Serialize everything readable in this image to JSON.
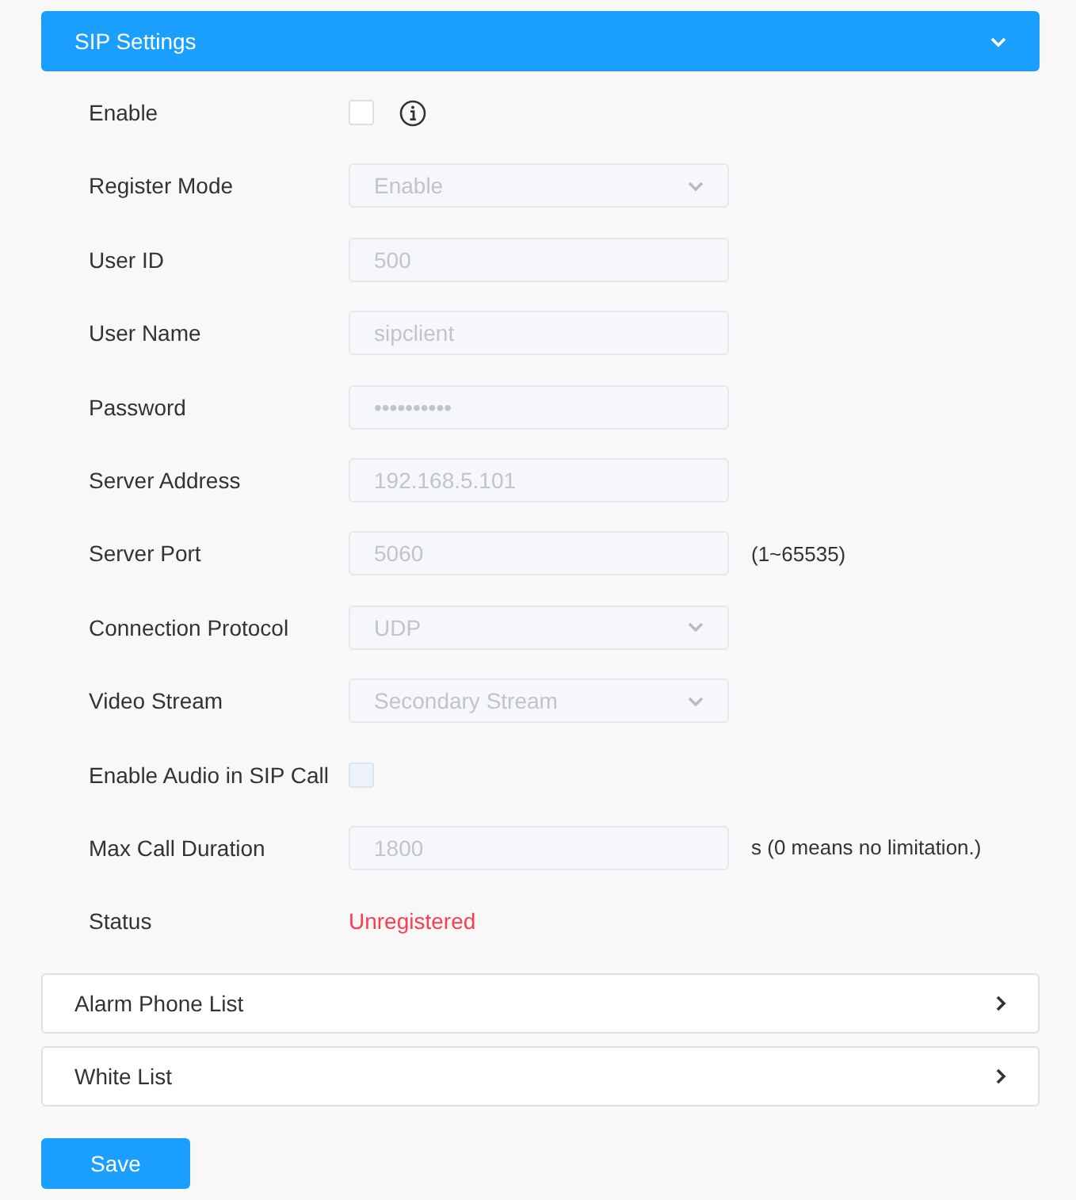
{
  "header": {
    "title": "SIP Settings",
    "expanded": true
  },
  "fields": [
    {
      "kind": "checkbox",
      "label": "Enable",
      "checked": false,
      "disabled": false,
      "info": true
    },
    {
      "kind": "select",
      "label": "Register Mode",
      "value": "Enable",
      "disabled": true
    },
    {
      "kind": "text",
      "label": "User ID",
      "value": "500",
      "disabled": true
    },
    {
      "kind": "text",
      "label": "User Name",
      "value": "sipclient",
      "disabled": true
    },
    {
      "kind": "text",
      "label": "Password",
      "value": "••••••••••",
      "disabled": true
    },
    {
      "kind": "text",
      "label": "Server Address",
      "value": "192.168.5.101",
      "disabled": true
    },
    {
      "kind": "text",
      "label": "Server Port",
      "value": "5060",
      "disabled": true,
      "hint": "(1~65535)"
    },
    {
      "kind": "select",
      "label": "Connection Protocol",
      "value": "UDP",
      "disabled": true
    },
    {
      "kind": "select",
      "label": "Video Stream",
      "value": "Secondary Stream",
      "disabled": true
    },
    {
      "kind": "checkbox",
      "label": "Enable Audio in SIP Call",
      "checked": false,
      "disabled": true
    },
    {
      "kind": "text",
      "label": "Max Call Duration",
      "value": "1800",
      "disabled": true,
      "hint": "s (0 means no limitation.)"
    },
    {
      "kind": "status",
      "label": "Status",
      "value": "Unregistered",
      "color": "#ff3b4f"
    }
  ],
  "sections": [
    {
      "title": "Alarm Phone List",
      "expanded": false
    },
    {
      "title": "White List",
      "expanded": false
    }
  ],
  "buttons": [
    "Save"
  ]
}
